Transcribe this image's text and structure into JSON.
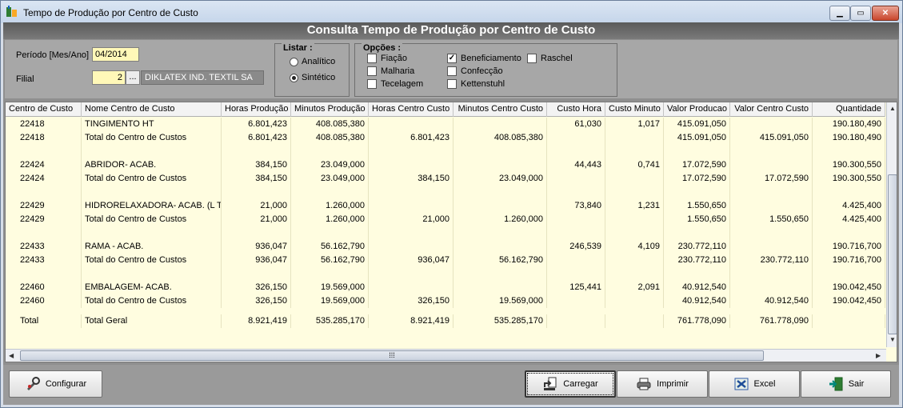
{
  "window": {
    "title": "Tempo de Produção por Centro de Custo"
  },
  "header": {
    "title": "Consulta Tempo de Produção por Centro de Custo"
  },
  "filters": {
    "periodo_label": "Período [Mes/Ano]",
    "periodo_value": "04/2014",
    "filial_label": "Filial",
    "filial_value": "2",
    "filial_dots": "...",
    "filial_name": "DIKLATEX IND. TEXTIL SA"
  },
  "listar": {
    "title": "Listar :",
    "options": [
      {
        "label": "Analítico",
        "selected": false
      },
      {
        "label": "Sintético",
        "selected": true
      }
    ]
  },
  "opcoes": {
    "title": "Opções :",
    "items": [
      {
        "label": "Fiação",
        "checked": false
      },
      {
        "label": "Malharia",
        "checked": false
      },
      {
        "label": "Tecelagem",
        "checked": false
      },
      {
        "label": "Beneficiamento",
        "checked": true
      },
      {
        "label": "Confecção",
        "checked": false
      },
      {
        "label": "Kettenstuhl",
        "checked": false
      },
      {
        "label": "Raschel",
        "checked": false
      }
    ]
  },
  "table": {
    "columns": [
      "Centro de Custo",
      "Nome Centro de Custo",
      "Horas Produção",
      "Minutos Produção",
      "Horas Centro Custo",
      "Minutos Centro Custo",
      "Custo Hora",
      "Custo Minuto",
      "Valor Producao",
      "Valor Centro Custo",
      "Quantidade"
    ],
    "rows": [
      [
        "22418",
        "TINGIMENTO  HT",
        "6.801,423",
        "408.085,380",
        "",
        "",
        "61,030",
        "1,017",
        "415.091,050",
        "",
        "190.180,490"
      ],
      [
        "22418",
        "Total do Centro de Custos",
        "6.801,423",
        "408.085,380",
        "6.801,423",
        "408.085,380",
        "",
        "",
        "415.091,050",
        "415.091,050",
        "190.180,490"
      ],
      [
        "",
        "",
        "",
        "",
        "",
        "",
        "",
        "",
        "",
        "",
        ""
      ],
      [
        "22424",
        "ABRIDOR- ACAB.",
        "384,150",
        "23.049,000",
        "",
        "",
        "44,443",
        "0,741",
        "17.072,590",
        "",
        "190.300,550"
      ],
      [
        "22424",
        "Total do Centro de Custos",
        "384,150",
        "23.049,000",
        "384,150",
        "23.049,000",
        "",
        "",
        "17.072,590",
        "17.072,590",
        "190.300,550"
      ],
      [
        "",
        "",
        "",
        "",
        "",
        "",
        "",
        "",
        "",
        "",
        ""
      ],
      [
        "22429",
        "HIDRORELAXADORA- ACAB. (L T)",
        "21,000",
        "1.260,000",
        "",
        "",
        "73,840",
        "1,231",
        "1.550,650",
        "",
        "4.425,400"
      ],
      [
        "22429",
        "Total do Centro de Custos",
        "21,000",
        "1.260,000",
        "21,000",
        "1.260,000",
        "",
        "",
        "1.550,650",
        "1.550,650",
        "4.425,400"
      ],
      [
        "",
        "",
        "",
        "",
        "",
        "",
        "",
        "",
        "",
        "",
        ""
      ],
      [
        "22433",
        "RAMA - ACAB.",
        "936,047",
        "56.162,790",
        "",
        "",
        "246,539",
        "4,109",
        "230.772,110",
        "",
        "190.716,700"
      ],
      [
        "22433",
        "Total do Centro de Custos",
        "936,047",
        "56.162,790",
        "936,047",
        "56.162,790",
        "",
        "",
        "230.772,110",
        "230.772,110",
        "190.716,700"
      ],
      [
        "",
        "",
        "",
        "",
        "",
        "",
        "",
        "",
        "",
        "",
        ""
      ],
      [
        "22460",
        "EMBALAGEM- ACAB.",
        "326,150",
        "19.569,000",
        "",
        "",
        "125,441",
        "2,091",
        "40.912,540",
        "",
        "190.042,450"
      ],
      [
        "22460",
        "Total do Centro de Custos",
        "326,150",
        "19.569,000",
        "326,150",
        "19.569,000",
        "",
        "",
        "40.912,540",
        "40.912,540",
        "190.042,450"
      ]
    ],
    "total": [
      "Total",
      "Total Geral",
      "8.921,419",
      "535.285,170",
      "8.921,419",
      "535.285,170",
      "",
      "",
      "761.778,090",
      "761.778,090",
      ""
    ]
  },
  "buttons": {
    "configurar": "Configurar",
    "carregar": "Carregar",
    "imprimir": "Imprimir",
    "excel": "Excel",
    "sair": "Sair"
  }
}
